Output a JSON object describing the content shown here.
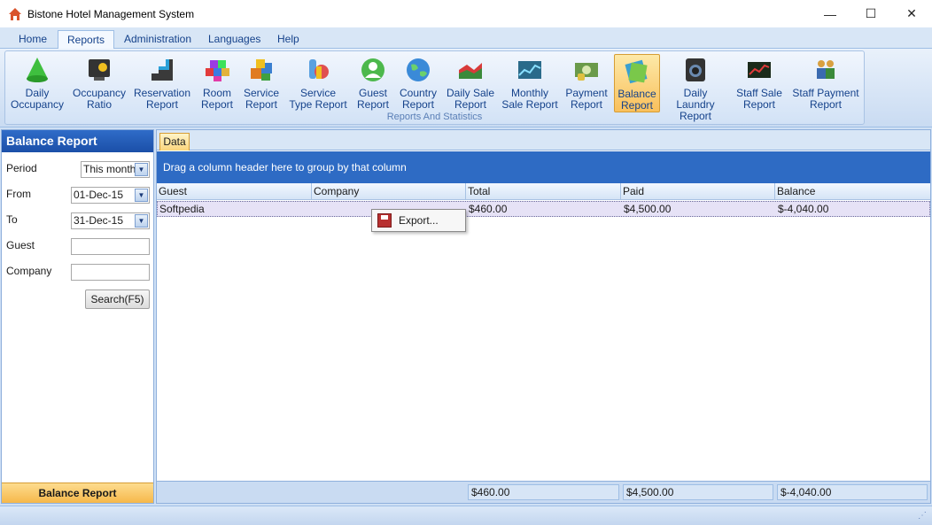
{
  "window": {
    "title": "Bistone Hotel Management System",
    "controls": {
      "minimize": "—",
      "maximize": "☐",
      "close": "✕"
    }
  },
  "menu": {
    "tabs": [
      {
        "label": "Home"
      },
      {
        "label": "Reports",
        "active": true
      },
      {
        "label": "Administration"
      },
      {
        "label": "Languages"
      },
      {
        "label": "Help"
      }
    ]
  },
  "ribbon": {
    "group_label": "Reports And Statistics",
    "items": [
      {
        "line1": "Daily",
        "line2": "Occupancy",
        "icon": "cone-icon"
      },
      {
        "line1": "Occupancy",
        "line2": "Ratio",
        "icon": "monitor-chart-icon"
      },
      {
        "line1": "Reservation",
        "line2": "Report",
        "icon": "stairs-icon"
      },
      {
        "line1": "Room",
        "line2": "Report",
        "icon": "cubes-icon"
      },
      {
        "line1": "Service",
        "line2": "Report",
        "icon": "boxes-icon"
      },
      {
        "line1": "Service",
        "line2": "Type Report",
        "icon": "toolbox-icon"
      },
      {
        "line1": "Guest",
        "line2": "Report",
        "icon": "user-icon"
      },
      {
        "line1": "Country",
        "line2": "Report",
        "icon": "globe-icon"
      },
      {
        "line1": "Daily Sale",
        "line2": "Report",
        "icon": "area-chart-icon"
      },
      {
        "line1": "Monthly",
        "line2": "Sale Report",
        "icon": "line-chart-icon"
      },
      {
        "line1": "Payment",
        "line2": "Report",
        "icon": "money-icon"
      },
      {
        "line1": "Balance",
        "line2": "Report",
        "icon": "balance-icon",
        "active": true
      },
      {
        "line1": "Daily Laundry",
        "line2": "Report",
        "icon": "washer-icon"
      },
      {
        "line1": "Staff Sale",
        "line2": "Report",
        "icon": "stock-chart-icon"
      },
      {
        "line1": "Staff Payment",
        "line2": "Report",
        "icon": "staff-money-icon"
      }
    ]
  },
  "left_panel": {
    "title": "Balance Report",
    "period_label": "Period",
    "period_value": "This month",
    "from_label": "From",
    "from_value": "01-Dec-15",
    "to_label": "To",
    "to_value": "31-Dec-15",
    "guest_label": "Guest",
    "guest_value": "",
    "company_label": "Company",
    "company_value": "",
    "search_label": "Search(F5)",
    "footer_label": "Balance Report"
  },
  "main": {
    "tab_label": "Data",
    "group_panel_text": "Drag a column header here to group by that column",
    "columns": [
      "Guest",
      "Company",
      "Total",
      "Paid",
      "Balance"
    ],
    "rows": [
      {
        "guest": "Softpedia",
        "company": "",
        "total": "$460.00",
        "paid": "$4,500.00",
        "balance": "$-4,040.00"
      }
    ],
    "summary": {
      "total": "$460.00",
      "paid": "$4,500.00",
      "balance": "$-4,040.00"
    }
  },
  "context_menu": {
    "items": [
      {
        "label": "Export...",
        "icon": "floppy-disk-icon"
      }
    ]
  },
  "colors": {
    "accent": "#2e6bc4",
    "selected": "#f9c05c",
    "ribbon_text": "#15428b"
  }
}
